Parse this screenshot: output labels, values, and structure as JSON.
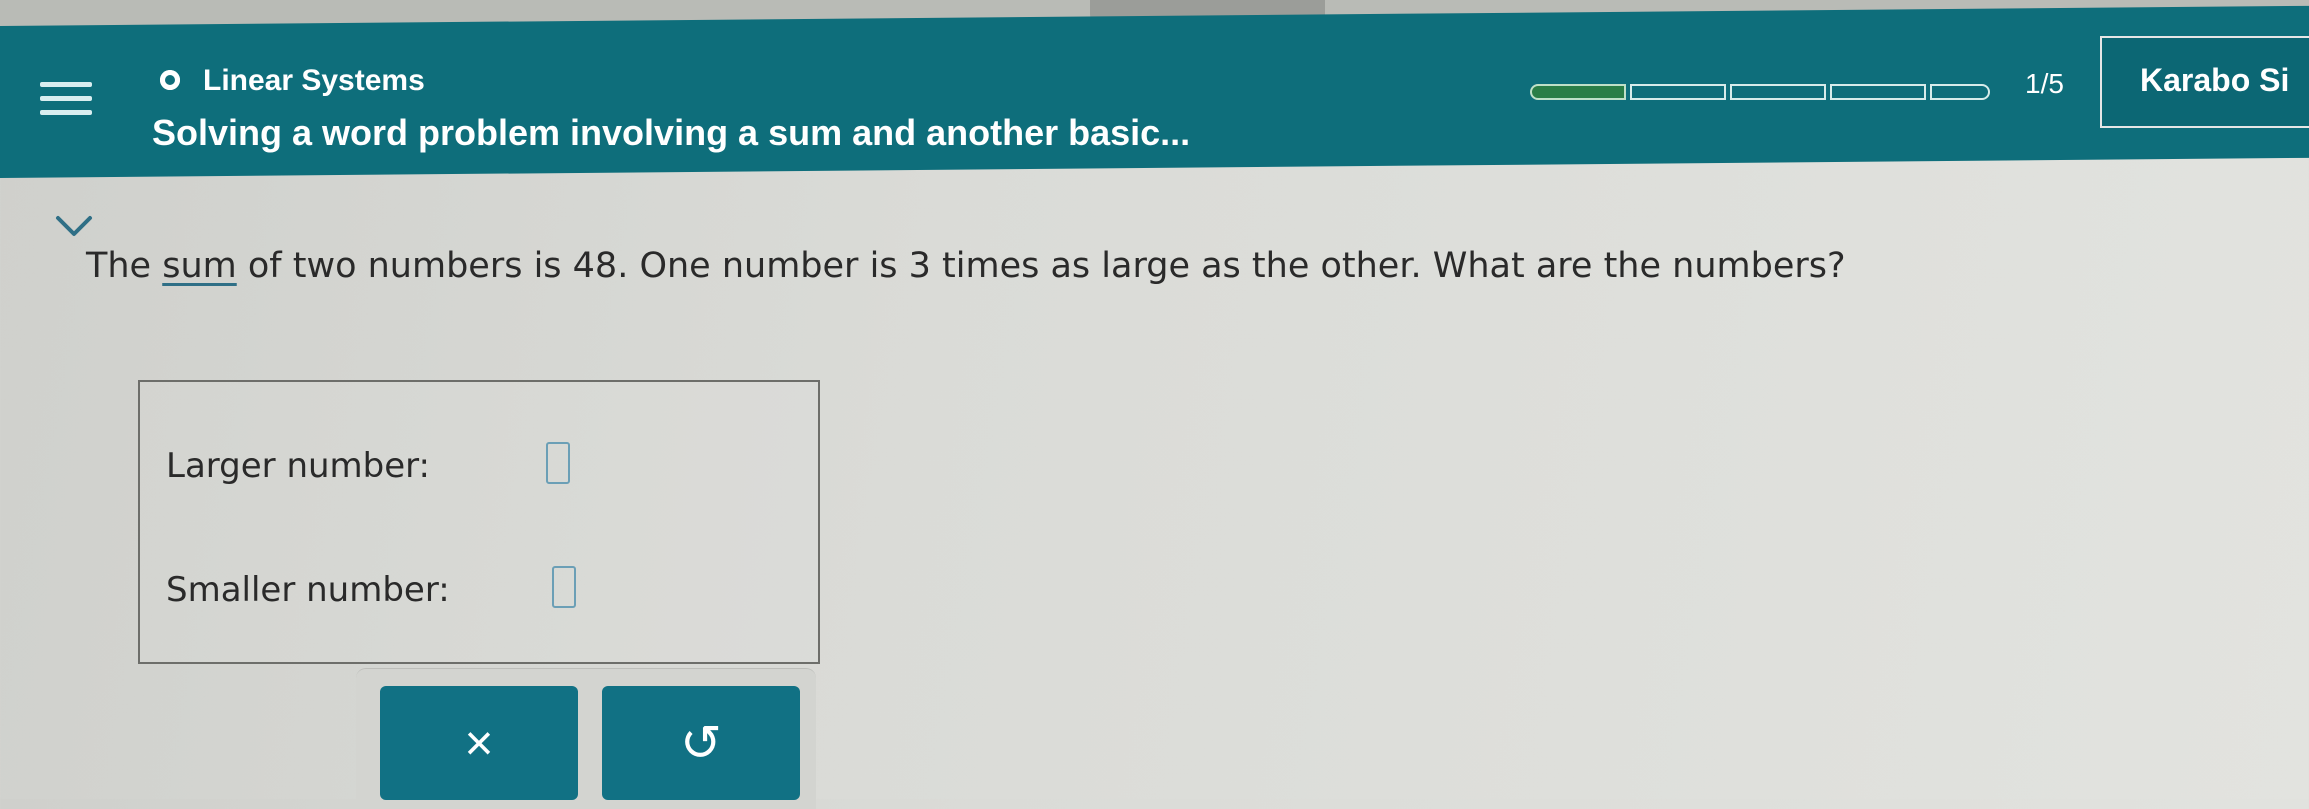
{
  "header": {
    "topic": "Linear Systems",
    "problem_title": "Solving a word problem involving a sum and another basic...",
    "progress": {
      "current": 1,
      "total": 5,
      "label": "1/5"
    },
    "user_name": "Karabo Si",
    "colors": {
      "bar": "#0e6e7b",
      "progress_fill": "#2a7e47"
    }
  },
  "question": {
    "pre": "The ",
    "term": "sum",
    "post": " of two numbers is 48. One number is 3 times as large as the other. What are the numbers?"
  },
  "answers": {
    "larger_label": "Larger number:",
    "larger_value": "",
    "smaller_label": "Smaller number:",
    "smaller_value": ""
  },
  "actions": {
    "clear_glyph": "×",
    "undo_glyph": "↺",
    "color": "#117184"
  },
  "icons": {
    "menu": "hamburger-menu-icon",
    "topic": "topic-radio-icon",
    "collapse": "chevron-down-icon",
    "clear": "close-icon",
    "undo": "undo-icon"
  }
}
